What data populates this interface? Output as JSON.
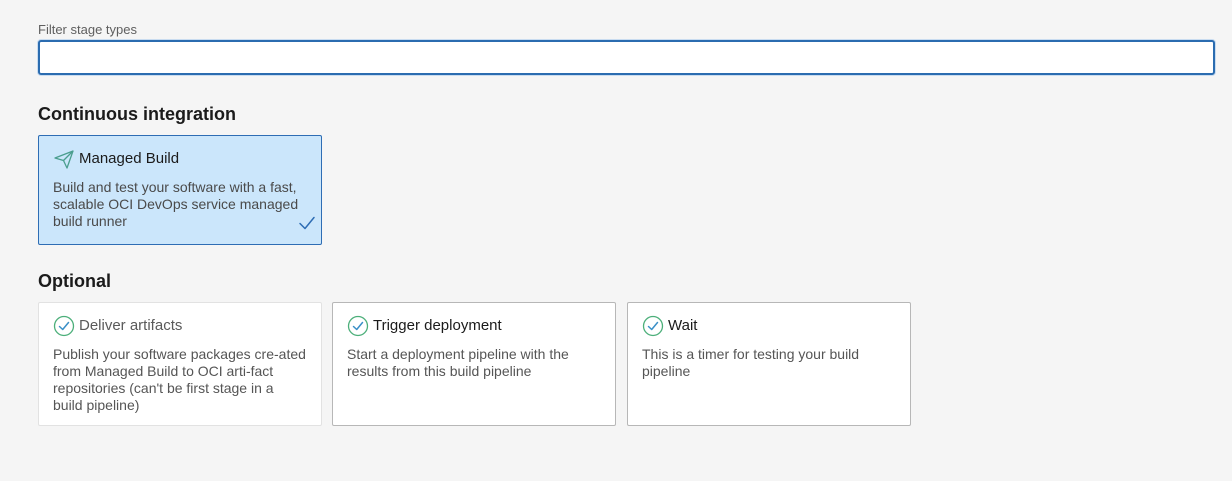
{
  "filter": {
    "label": "Filter stage types",
    "value": "",
    "placeholder": ""
  },
  "sections": {
    "ci": {
      "title": "Continuous integration",
      "cards": [
        {
          "title": "Managed Build",
          "description": "Build and test your software with a fast, scalable OCI DevOps service managed build runner",
          "icon": "paper-plane-icon",
          "selected": true
        }
      ]
    },
    "optional": {
      "title": "Optional",
      "cards": [
        {
          "title": "Deliver artifacts",
          "description": "Publish your software packages cre-ated from Managed Build to OCI arti-fact repositories (can't be first stage in a build pipeline)",
          "icon": "check-circle-icon",
          "disabled": true
        },
        {
          "title": "Trigger deployment",
          "description": "Start a deployment pipeline with the results from this build pipeline",
          "icon": "check-circle-icon"
        },
        {
          "title": "Wait",
          "description": "This is a timer for testing your build pipeline",
          "icon": "check-circle-icon"
        }
      ]
    }
  },
  "colors": {
    "accent": "#2e6db4",
    "selected_bg": "#cbe6fb",
    "icon_green": "#4caf7a",
    "page_bg": "#f5f5f5"
  }
}
